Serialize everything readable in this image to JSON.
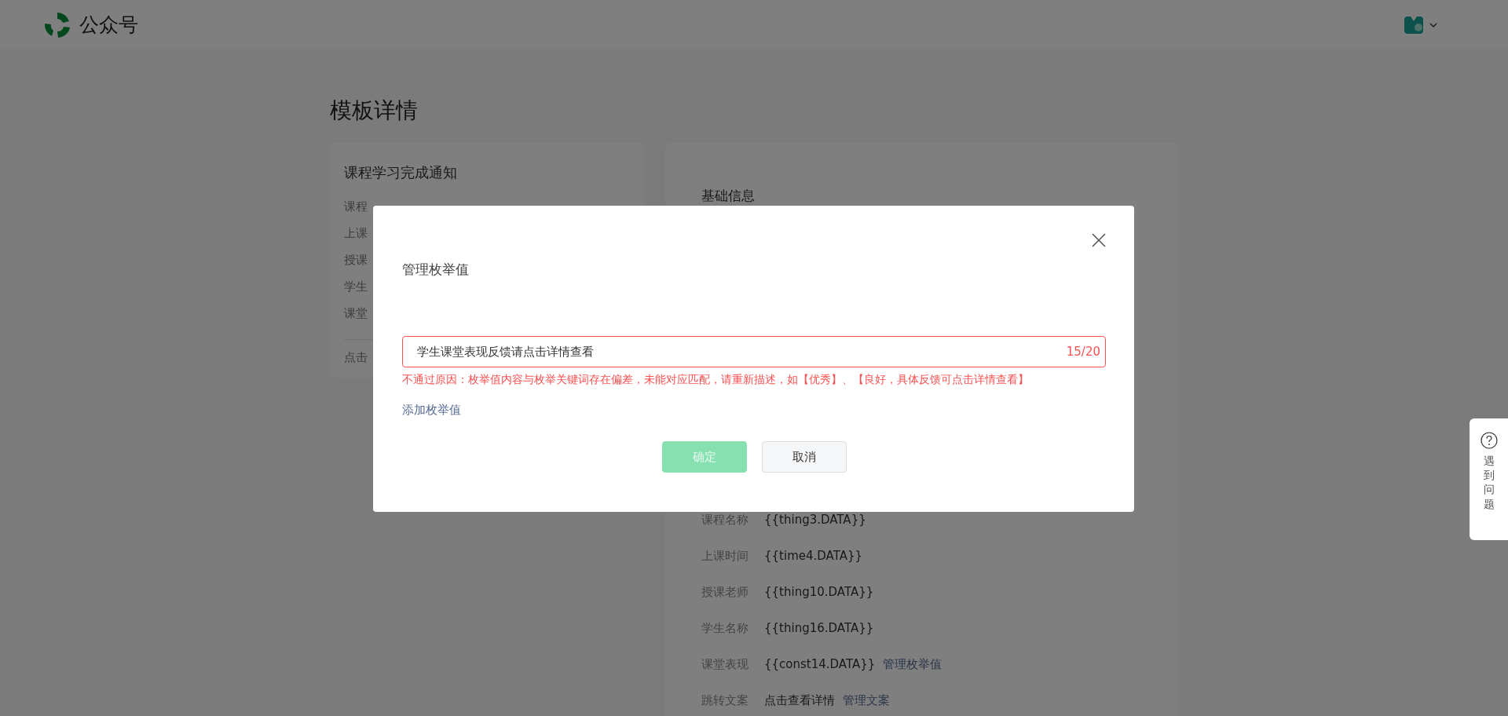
{
  "header": {
    "brand": "公众号"
  },
  "page_title": "模板详情",
  "preview_card": {
    "title": "课程学习完成通知",
    "rows": [
      "课程",
      "上课",
      "授课",
      "学生",
      "课堂"
    ],
    "footer": "点击"
  },
  "detail_card": {
    "section_title": "基础信息",
    "fields": [
      {
        "label": "课程名称",
        "value": "{{thing3.DATA}}"
      },
      {
        "label": "上课时间",
        "value": "{{time4.DATA}}"
      },
      {
        "label": "授课老师",
        "value": "{{thing10.DATA}}"
      },
      {
        "label": "学生名称",
        "value": "{{thing16.DATA}}"
      },
      {
        "label": "课堂表现",
        "value": "{{const14.DATA}}",
        "link": "管理枚举值"
      },
      {
        "label": "跳转文案",
        "value": "点击查看详情",
        "link": "管理文案"
      }
    ]
  },
  "dialog": {
    "title": "管理枚举值",
    "field": {
      "value": "学生课堂表现反馈请点击详情查看",
      "counter": "15/20",
      "error": true
    },
    "error_message": "不通过原因：枚举值内容与枚举关键词存在偏差，未能对应匹配，请重新描述，如【优秀】、【良好，具体反馈可点击详情查看】",
    "add_link": "添加枚举值",
    "buttons": [
      {
        "label": "确定",
        "kind": "primary",
        "disabled": true
      },
      {
        "label": "取消",
        "kind": "default",
        "disabled": false
      }
    ]
  },
  "help_widget": {
    "label": "遇到问题"
  }
}
